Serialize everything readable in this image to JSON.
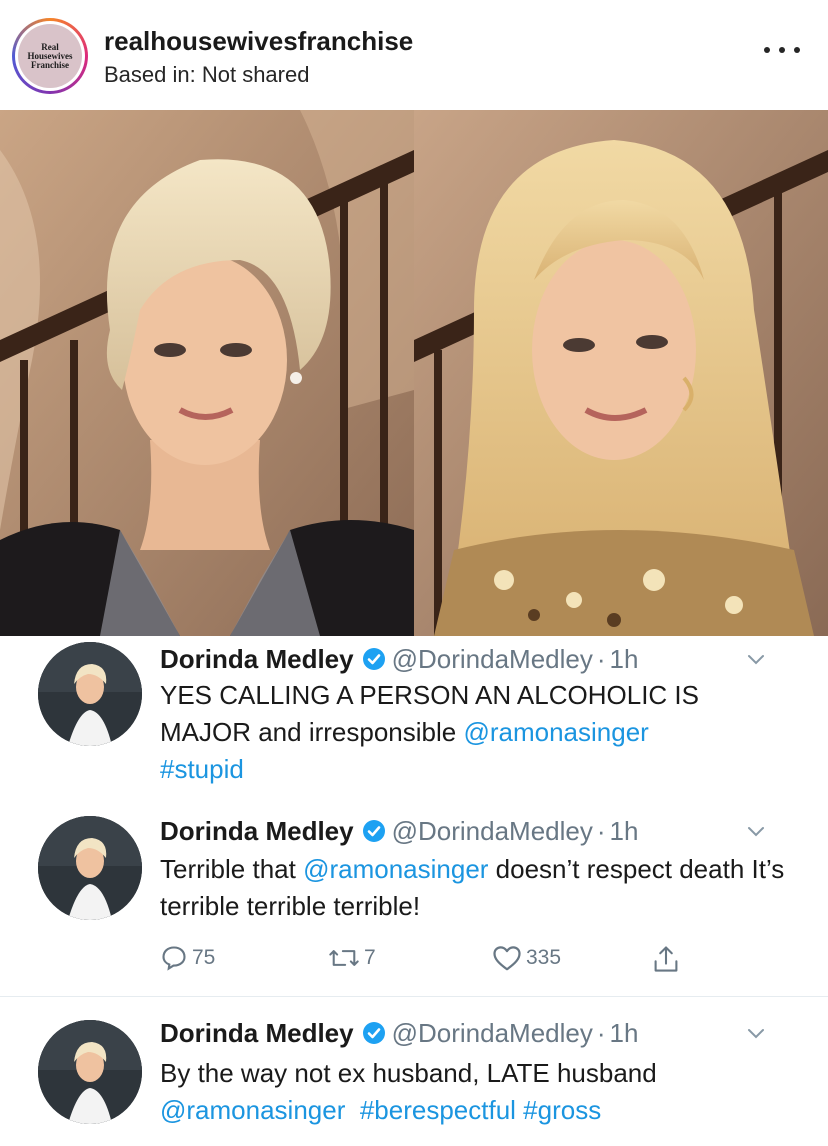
{
  "post": {
    "username": "realhousewivesfranchise",
    "location": "Based in: Not shared",
    "avatar": {
      "line1": "Real",
      "line2": "Housewives",
      "line3": "Franchise"
    },
    "more_icon": "more-horizontal-icon"
  },
  "tweets": [
    {
      "name": "Dorinda Medley",
      "handle": "@DorindaMedley",
      "separator": "·",
      "time": "1h",
      "text_parts": {
        "a": "YES CALLING A PERSON AN ALCOHOLIC IS MAJOR and irresponsible ",
        "b": "@ramonasinger",
        "c": "#stupid"
      }
    },
    {
      "name": "Dorinda Medley",
      "handle": "@DorindaMedley",
      "separator": "·",
      "time": "1h",
      "text_parts": {
        "a": "Terrible that ",
        "b": "@ramonasinger",
        "c": " doesn’t respect death It’s terrible terrible terrible!"
      },
      "actions": {
        "replies": "75",
        "retweets": "7",
        "likes": "335"
      }
    },
    {
      "name": "Dorinda Medley",
      "handle": "@DorindaMedley",
      "separator": "·",
      "time": "1h",
      "text_parts": {
        "a": "By the way not ex husband, LATE husband",
        "b": "@ramonasinger",
        "c": "#berespectful",
        "d": "#gross"
      }
    }
  ],
  "colors": {
    "link": "#1b95e0",
    "verified": "#1da1f2",
    "muted": "#687784"
  },
  "icons": [
    "verified-badge-icon",
    "chevron-down-icon",
    "reply-icon",
    "retweet-icon",
    "like-heart-icon",
    "share-icon"
  ]
}
